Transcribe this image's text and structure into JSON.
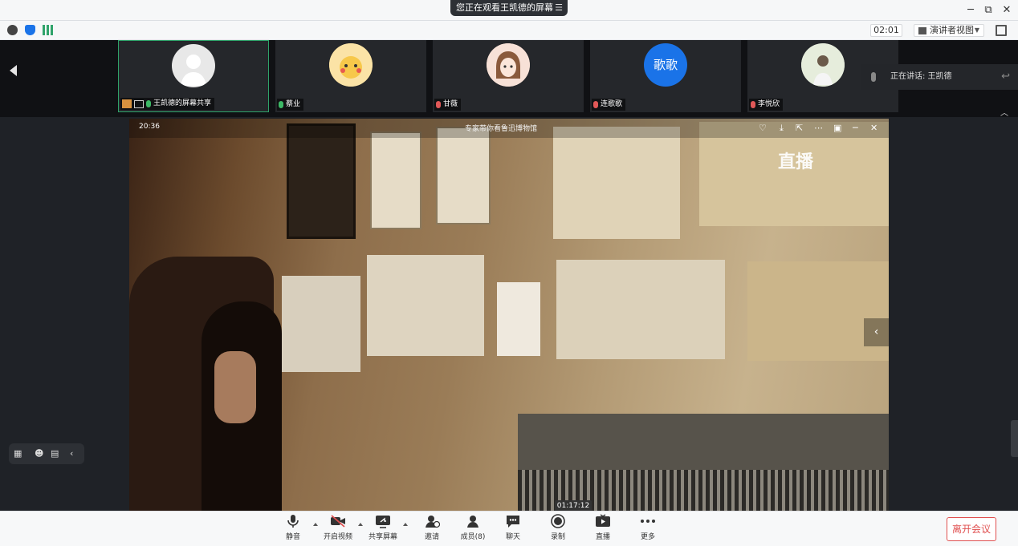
{
  "titlebar": {
    "share_notice": "您正在观看王凯德的屏幕",
    "share_icon": "menu-lines-icon",
    "minimize": "─",
    "restore": "⧉",
    "close": "✕"
  },
  "infobar": {
    "timer": "02:01",
    "view_mode": "演讲者视图"
  },
  "participants": [
    {
      "label": "王凯德的屏幕共享",
      "mic": "on",
      "active": true,
      "avatar_color": "#e8e8e8"
    },
    {
      "label": "蔡业",
      "mic": "on",
      "active": false,
      "avatar_color": "#f3d98a"
    },
    {
      "label": "甘薇",
      "mic": "off",
      "active": false,
      "avatar_color": "#f4d3c4"
    },
    {
      "label": "连歌歌",
      "mic": "off",
      "active": false,
      "avatar_color": "#1a73e8",
      "avatar_text": "歌歌"
    },
    {
      "label": "李悦欣",
      "mic": "off",
      "active": false,
      "avatar_color": "#dfe8d6"
    }
  ],
  "speaking": {
    "text": "正在讲话: 王凯德"
  },
  "video": {
    "time": "20:36",
    "title": "专家带你看鲁迅博物馆",
    "logo": "直播",
    "duration": "01:17:12"
  },
  "controls": [
    {
      "label": "静音",
      "icon": "microphone-icon"
    },
    {
      "label": "开启视频",
      "icon": "video-off-icon"
    },
    {
      "label": "共享屏幕",
      "icon": "share-screen-icon"
    },
    {
      "label": "邀请",
      "icon": "invite-user-icon"
    },
    {
      "label": "成员(8)",
      "icon": "members-icon"
    },
    {
      "label": "聊天",
      "icon": "chat-icon"
    },
    {
      "label": "录制",
      "icon": "record-icon"
    },
    {
      "label": "直播",
      "icon": "live-stream-icon"
    },
    {
      "label": "更多",
      "icon": "more-icon"
    }
  ],
  "leave_button": "离开会议",
  "colors": {
    "accent_green": "#2fa36a",
    "mic_on": "#3cb865",
    "mic_off": "#e05858",
    "leave_red": "#e05050",
    "avatar_blue": "#1a73e8"
  }
}
